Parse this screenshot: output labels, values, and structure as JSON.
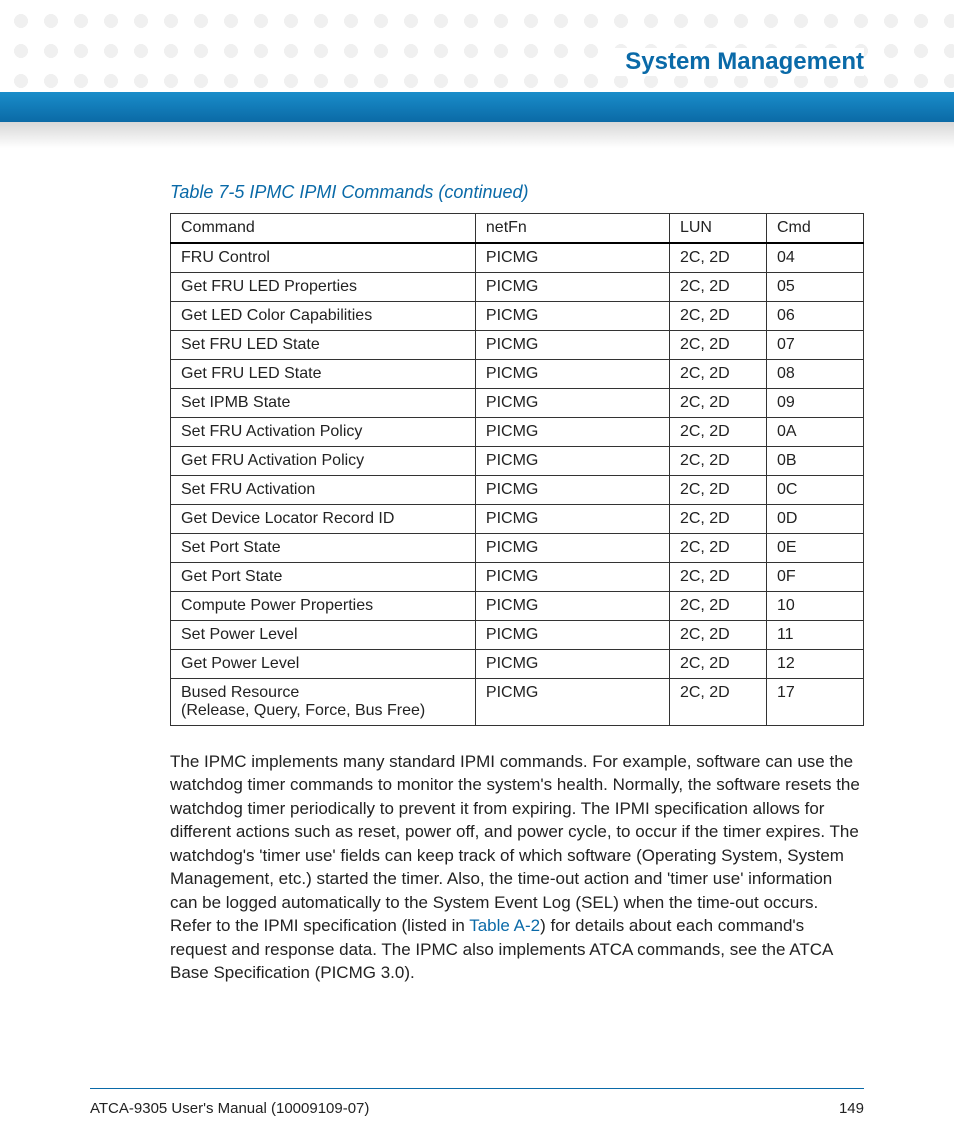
{
  "header": {
    "section_title": "System Management"
  },
  "table": {
    "caption": "Table 7-5 IPMC IPMI Commands (continued)",
    "columns": [
      "Command",
      "netFn",
      "LUN",
      "Cmd"
    ],
    "rows": [
      {
        "command": "FRU Control",
        "netfn": "PICMG",
        "lun": "2C, 2D",
        "code": "04"
      },
      {
        "command": "Get FRU LED Properties",
        "netfn": "PICMG",
        "lun": "2C, 2D",
        "code": "05"
      },
      {
        "command": "Get LED Color Capabilities",
        "netfn": "PICMG",
        "lun": "2C, 2D",
        "code": "06"
      },
      {
        "command": "Set FRU LED State",
        "netfn": "PICMG",
        "lun": "2C, 2D",
        "code": "07"
      },
      {
        "command": "Get FRU LED State",
        "netfn": "PICMG",
        "lun": "2C, 2D",
        "code": "08"
      },
      {
        "command": "Set IPMB State",
        "netfn": "PICMG",
        "lun": "2C, 2D",
        "code": "09"
      },
      {
        "command": "Set FRU Activation Policy",
        "netfn": "PICMG",
        "lun": "2C, 2D",
        "code": "0A"
      },
      {
        "command": "Get FRU Activation Policy",
        "netfn": "PICMG",
        "lun": "2C, 2D",
        "code": "0B"
      },
      {
        "command": "Set FRU Activation",
        "netfn": "PICMG",
        "lun": "2C, 2D",
        "code": "0C"
      },
      {
        "command": "Get Device Locator Record ID",
        "netfn": "PICMG",
        "lun": "2C, 2D",
        "code": "0D"
      },
      {
        "command": "Set Port State",
        "netfn": "PICMG",
        "lun": "2C, 2D",
        "code": "0E"
      },
      {
        "command": "Get Port State",
        "netfn": "PICMG",
        "lun": "2C, 2D",
        "code": "0F"
      },
      {
        "command": "Compute Power Properties",
        "netfn": "PICMG",
        "lun": "2C, 2D",
        "code": "10"
      },
      {
        "command": "Set Power Level",
        "netfn": "PICMG",
        "lun": "2C, 2D",
        "code": "11"
      },
      {
        "command": "Get Power Level",
        "netfn": "PICMG",
        "lun": "2C, 2D",
        "code": "12"
      },
      {
        "command": "Bused Resource",
        "command_sub": "(Release, Query, Force, Bus Free)",
        "netfn": "PICMG",
        "lun": "2C, 2D",
        "code": "17"
      }
    ]
  },
  "paragraph": {
    "p1a": "The IPMC implements many standard IPMI commands. For example, software can use the watchdog timer commands to monitor the system's health. Normally, the software resets the watchdog timer periodically to prevent it from expiring. The IPMI specification allows for different actions such as reset, power off, and power cycle, to occur if the timer expires. The watchdog's 'timer use' fields can keep track of which software (Operating System, System Management, etc.) started the timer. Also, the time-out action and 'timer use' information can be logged automatically to the System Event Log (SEL) when the time-out occurs. Refer to the IPMI specification (listed in ",
    "link": "Table A-2",
    "p1b": ") for details about each command's request and response data. The IPMC also implements ATCA commands, see the ATCA Base Specification (PICMG 3.0)."
  },
  "footer": {
    "left": "ATCA-9305 User's Manual (10009109-07)",
    "right": "149"
  }
}
